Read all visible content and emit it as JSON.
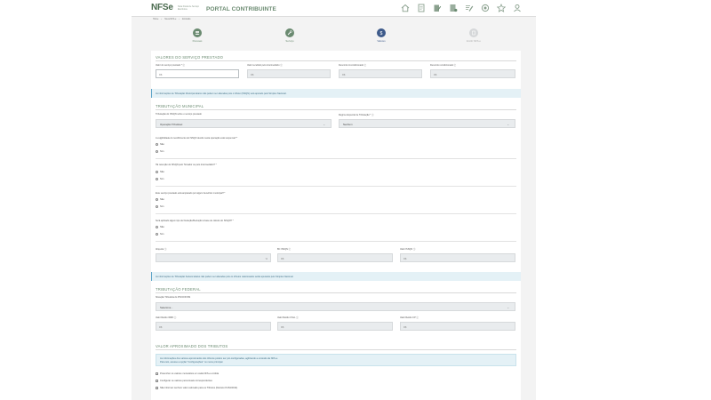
{
  "header": {
    "logo_main": "NFSe",
    "logo_sub": "Nota Fiscal de Serviço Eletrônica",
    "portal_title": "PORTAL CONTRIBUINTE",
    "icons": [
      "home-icon",
      "document-icon",
      "document-edit-icon",
      "document-list-icon",
      "pencil-list-icon",
      "gear-badge-icon",
      "star-icon",
      "user-icon"
    ]
  },
  "breadcrumb": [
    "Home",
    "Nova NFS-e",
    "Emissão"
  ],
  "steps": [
    {
      "label": "Pessoas",
      "icon": "people-icon",
      "state": "done"
    },
    {
      "label": "Serviço",
      "icon": "wrench-icon",
      "state": "done"
    },
    {
      "label": "Valores",
      "icon": "dollar-icon",
      "state": "current"
    },
    {
      "label": "Emitir NFS-e",
      "icon": "document-icon",
      "state": "pending"
    }
  ],
  "valores": {
    "title": "VALORES DO SERVIÇO PRESTADO",
    "fields": [
      {
        "label": "Valor do serviço prestado * ⓘ",
        "prefix": "R$",
        "value": ""
      },
      {
        "label": "Valor recebido pelo intermediário ⓘ",
        "prefix": "R$",
        "value": ""
      },
      {
        "label": "Desconto incondicionado ⓘ",
        "prefix": "R$",
        "value": ""
      },
      {
        "label": "Desconto condicionado ⓘ",
        "prefix": "R$",
        "value": ""
      }
    ]
  },
  "info_municipal": "As informações de Tributação Municipal abaixo não podem ser alteradas pois o tributo (ISSQN) será apurado pelo Simples Nacional.",
  "municipal": {
    "title": "TRIBUTAÇÃO MUNICIPAL",
    "tributacao_label": "Tributação do ISSQN sobre o serviço prestado",
    "tributacao_value": "Operação Tributável",
    "regime_label": "Regime Especial de Tributação * ⓘ",
    "regime_value": "Nenhum",
    "q1": "A exigibilidade do recolhimento do ISSQN devido nesta operação está suspensa? *",
    "q2": "Há retenção do ISSQN pelo Tomador ou pelo Intermediário? *",
    "q3": "Este serviço prestado está amparado por algum benefício municipal? *",
    "q4": "Será aplicado algum tipo de Dedução/Redução à base de cálculo do ISSQN? *",
    "opt_no": "Não",
    "opt_yes": "Sim",
    "aliquota_label": "Alíquota ⓘ",
    "aliquota_suffix": "%",
    "bc_label": "BC ISSQN ⓘ",
    "bc_prefix": "R$",
    "valor_label": "Valor ISSQN ⓘ",
    "valor_prefix": "R$"
  },
  "info_federal": "As informações de Tributação Federal abaixo não podem ser alteradas pois os tributos relacionados serão apurados pelo Simples Nacional.",
  "federal": {
    "title": "TRIBUTAÇÃO FEDERAL",
    "situacao_label": "Situação Tributária do PIS/COFINS",
    "situacao_value": "Selecione...",
    "irrf_label": "Valor Retido IRRF ⓘ",
    "csll_label": "Valor Retido CSLL ⓘ",
    "cp_label": "Valor Retido CP ⓘ",
    "prefix": "R$"
  },
  "aproximado": {
    "title": "VALOR APROXIMADO DOS TRIBUTOS",
    "note_line1": "As informações dos valores aproximados dos tributos podem ser pré-configuradas, agilizando a emissão da NFS-e.",
    "note_line2": "Para isto, acesse a opção \"Configurações\" no menu principal.",
    "options": [
      "Preencher os valores monetários em cada NFS-e emitida",
      "Configurar os valores percentuais correspondentes",
      "Não informar nenhum valor estimado para os Tributos (Decreto 8.264/2014)"
    ]
  }
}
